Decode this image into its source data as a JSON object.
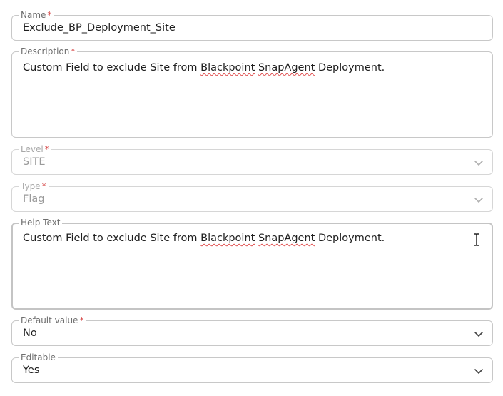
{
  "form": {
    "name": {
      "label": "Name",
      "required_mark": "*",
      "value": "Exclude_BP_Deployment_Site"
    },
    "description": {
      "label": "Description",
      "required_mark": "*",
      "text_before": "Custom Field to exclude Site from ",
      "word1": "Blackpoint",
      "space": " ",
      "word2": "SnapAgent",
      "text_after": " Deployment."
    },
    "level": {
      "label": "Level",
      "required_mark": "*",
      "value": "SITE",
      "disabled": true
    },
    "type": {
      "label": "Type",
      "required_mark": "*",
      "value": "Flag",
      "disabled": true
    },
    "help_text": {
      "label": "Help Text",
      "text_before": "Custom Field to exclude Site from ",
      "word1": "Blackpoint",
      "space": " ",
      "word2": "SnapAgent",
      "text_after": " Deployment."
    },
    "default_value": {
      "label": "Default value",
      "required_mark": "*",
      "value": "No"
    },
    "editable": {
      "label": "Editable",
      "value": "Yes"
    }
  },
  "icons": {
    "chevron": "chevron-down-icon",
    "cursor": "text-cursor-icon"
  },
  "colors": {
    "border": "#c8c8c8",
    "required": "#d64545",
    "spellcheck": "#e05050",
    "disabled_text": "#9b9b9b"
  }
}
